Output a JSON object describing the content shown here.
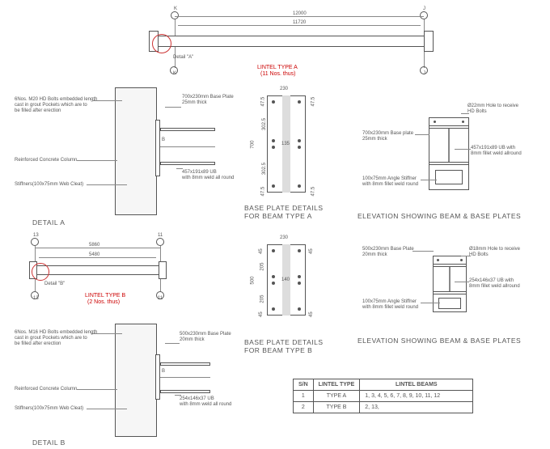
{
  "top": {
    "grid_left": "K",
    "grid_left2": "K",
    "grid_right": "J",
    "grid_right2": "J",
    "span_total": "12000",
    "span_inner": "11720",
    "detail_callout": "Detail \"A\"",
    "title": "LINTEL TYPE A",
    "subtitle": "(11 Nos. thus)"
  },
  "detail_a": {
    "note1_line1": "6Nos. M20 HD Bolts embedded length",
    "note1_line2": "cast in grout Pockets which are to",
    "note1_line3": "be filled after erection",
    "note2": "Reinforced Concrete Column",
    "note3": "Stiffners(100x75mm Web Cleat)",
    "callout1_line1": "700x230mm Base Plate",
    "callout1_line2": "25mm thick",
    "callout2_line1": "457x191x89 UB",
    "callout2_line2": "with 8mm weld all round",
    "cutline": "B",
    "title": "DETAIL A"
  },
  "bp_a": {
    "w": "230",
    "h": "700",
    "row1": "47.5",
    "row2": "302.5",
    "gauge": "135",
    "title1": "BASE PLATE DETAILS",
    "title2": "FOR BEAM TYPE A",
    "row1b": "47.5",
    "row2b": "302.5",
    "col1": "47.5",
    "col1b": "47.5"
  },
  "elev_a": {
    "note1_line1": "Ø22mm Hole to receive",
    "note1_line2": "HD Bolts",
    "note2_line1": "700x230mm Base plate",
    "note2_line2": "25mm thick",
    "note3_line1": "457x191x89 UB with",
    "note3_line2": "8mm fillet weld allround",
    "note4_line1": "100x75mm Angle Stiffner",
    "note4_line2": "with 8mm fillet weld round",
    "title": "ELEVATION SHOWING BEAM & BASE PLATES"
  },
  "mid": {
    "grid_left": "13",
    "grid_left2": "13",
    "grid_right": "11",
    "grid_right2": "11",
    "span_total": "5860",
    "span_inner": "5480",
    "detail_callout": "Detail \"B\"",
    "title": "LINTEL TYPE B",
    "subtitle": "(2 Nos. thus)"
  },
  "bp_b": {
    "w": "230",
    "h": "500",
    "row1": "45",
    "row2": "205",
    "gauge": "140",
    "title1": "BASE PLATE DETAILS",
    "title2": "FOR BEAM TYPE B",
    "row1b": "45",
    "row2b": "205",
    "col1": "45",
    "col1b": "45"
  },
  "elev_b": {
    "note1_line1": "500x230mm Base Plate",
    "note1_line2": "20mm thick",
    "note2_line1": "Ø18mm Hole to receive",
    "note2_line2": "HD Bolts",
    "note3_line1": "254x146x37 UB with",
    "note3_line2": "8mm fillet weld allround",
    "note4_line1": "100x75mm Angle Stiffner",
    "note4_line2": "with 8mm fillet weld round",
    "title": "ELEVATION SHOWING BEAM & BASE PLATES"
  },
  "detail_b": {
    "note1_line1": "6Nos. M16 HD Bolts embedded length",
    "note1_line2": "cast in grout Pockets which are to",
    "note1_line3": "be filled after erection",
    "note2": "Reinforced Concrete Column",
    "note3": "Stiffners(100x75mm Web Cleat)",
    "callout1_line1": "500x230mm Base Plate",
    "callout1_line2": "20mm thick",
    "callout2_line1": "254x146x37 UB",
    "callout2_line2": "with 8mm weld all round",
    "cutline": "B",
    "title": "DETAIL B"
  },
  "table": {
    "h_sn": "S/N",
    "h_type": "LINTEL  TYPE",
    "h_beams": "LINTEL BEAMS",
    "rows": [
      {
        "sn": "1",
        "type": "TYPE A",
        "beams": "1, 3, 4, 5, 6, 7, 8, 9, 10, 11, 12"
      },
      {
        "sn": "2",
        "type": "TYPE B",
        "beams": "2, 13,"
      }
    ]
  }
}
